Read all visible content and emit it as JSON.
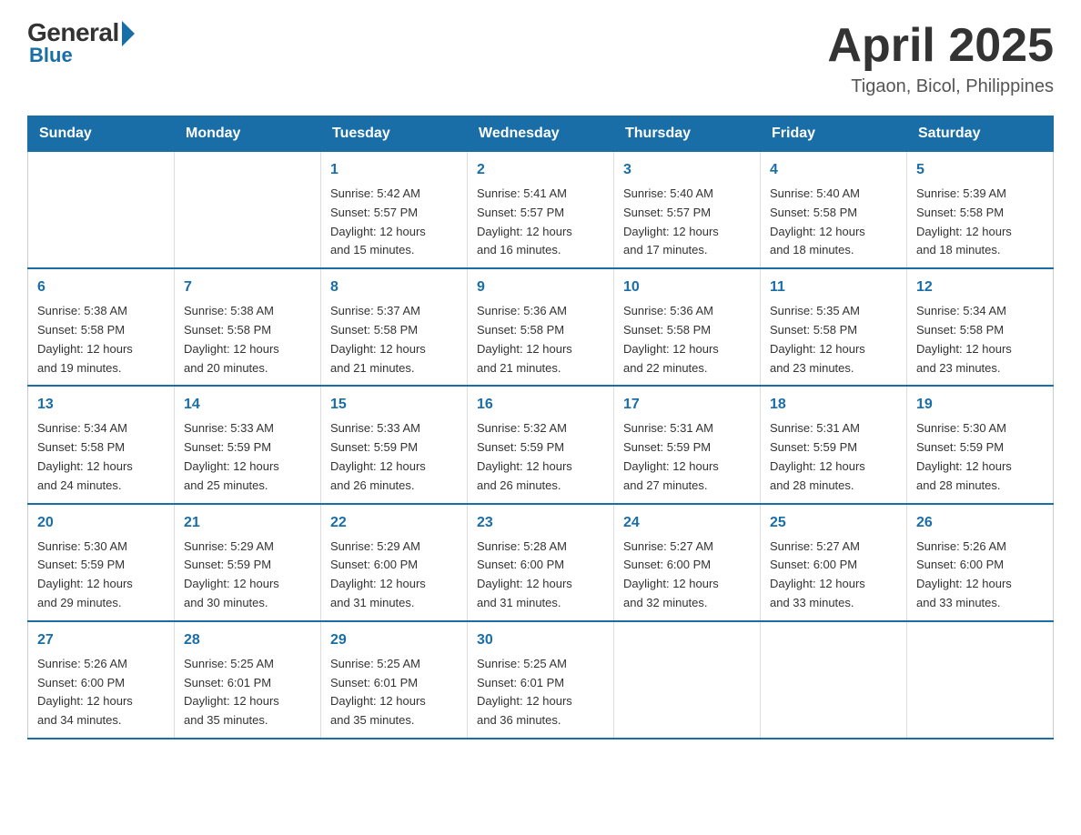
{
  "logo": {
    "general": "General",
    "blue": "Blue"
  },
  "header": {
    "month": "April 2025",
    "location": "Tigaon, Bicol, Philippines"
  },
  "days_of_week": [
    "Sunday",
    "Monday",
    "Tuesday",
    "Wednesday",
    "Thursday",
    "Friday",
    "Saturday"
  ],
  "weeks": [
    [
      {
        "day": "",
        "info": ""
      },
      {
        "day": "",
        "info": ""
      },
      {
        "day": "1",
        "info": "Sunrise: 5:42 AM\nSunset: 5:57 PM\nDaylight: 12 hours\nand 15 minutes."
      },
      {
        "day": "2",
        "info": "Sunrise: 5:41 AM\nSunset: 5:57 PM\nDaylight: 12 hours\nand 16 minutes."
      },
      {
        "day": "3",
        "info": "Sunrise: 5:40 AM\nSunset: 5:57 PM\nDaylight: 12 hours\nand 17 minutes."
      },
      {
        "day": "4",
        "info": "Sunrise: 5:40 AM\nSunset: 5:58 PM\nDaylight: 12 hours\nand 18 minutes."
      },
      {
        "day": "5",
        "info": "Sunrise: 5:39 AM\nSunset: 5:58 PM\nDaylight: 12 hours\nand 18 minutes."
      }
    ],
    [
      {
        "day": "6",
        "info": "Sunrise: 5:38 AM\nSunset: 5:58 PM\nDaylight: 12 hours\nand 19 minutes."
      },
      {
        "day": "7",
        "info": "Sunrise: 5:38 AM\nSunset: 5:58 PM\nDaylight: 12 hours\nand 20 minutes."
      },
      {
        "day": "8",
        "info": "Sunrise: 5:37 AM\nSunset: 5:58 PM\nDaylight: 12 hours\nand 21 minutes."
      },
      {
        "day": "9",
        "info": "Sunrise: 5:36 AM\nSunset: 5:58 PM\nDaylight: 12 hours\nand 21 minutes."
      },
      {
        "day": "10",
        "info": "Sunrise: 5:36 AM\nSunset: 5:58 PM\nDaylight: 12 hours\nand 22 minutes."
      },
      {
        "day": "11",
        "info": "Sunrise: 5:35 AM\nSunset: 5:58 PM\nDaylight: 12 hours\nand 23 minutes."
      },
      {
        "day": "12",
        "info": "Sunrise: 5:34 AM\nSunset: 5:58 PM\nDaylight: 12 hours\nand 23 minutes."
      }
    ],
    [
      {
        "day": "13",
        "info": "Sunrise: 5:34 AM\nSunset: 5:58 PM\nDaylight: 12 hours\nand 24 minutes."
      },
      {
        "day": "14",
        "info": "Sunrise: 5:33 AM\nSunset: 5:59 PM\nDaylight: 12 hours\nand 25 minutes."
      },
      {
        "day": "15",
        "info": "Sunrise: 5:33 AM\nSunset: 5:59 PM\nDaylight: 12 hours\nand 26 minutes."
      },
      {
        "day": "16",
        "info": "Sunrise: 5:32 AM\nSunset: 5:59 PM\nDaylight: 12 hours\nand 26 minutes."
      },
      {
        "day": "17",
        "info": "Sunrise: 5:31 AM\nSunset: 5:59 PM\nDaylight: 12 hours\nand 27 minutes."
      },
      {
        "day": "18",
        "info": "Sunrise: 5:31 AM\nSunset: 5:59 PM\nDaylight: 12 hours\nand 28 minutes."
      },
      {
        "day": "19",
        "info": "Sunrise: 5:30 AM\nSunset: 5:59 PM\nDaylight: 12 hours\nand 28 minutes."
      }
    ],
    [
      {
        "day": "20",
        "info": "Sunrise: 5:30 AM\nSunset: 5:59 PM\nDaylight: 12 hours\nand 29 minutes."
      },
      {
        "day": "21",
        "info": "Sunrise: 5:29 AM\nSunset: 5:59 PM\nDaylight: 12 hours\nand 30 minutes."
      },
      {
        "day": "22",
        "info": "Sunrise: 5:29 AM\nSunset: 6:00 PM\nDaylight: 12 hours\nand 31 minutes."
      },
      {
        "day": "23",
        "info": "Sunrise: 5:28 AM\nSunset: 6:00 PM\nDaylight: 12 hours\nand 31 minutes."
      },
      {
        "day": "24",
        "info": "Sunrise: 5:27 AM\nSunset: 6:00 PM\nDaylight: 12 hours\nand 32 minutes."
      },
      {
        "day": "25",
        "info": "Sunrise: 5:27 AM\nSunset: 6:00 PM\nDaylight: 12 hours\nand 33 minutes."
      },
      {
        "day": "26",
        "info": "Sunrise: 5:26 AM\nSunset: 6:00 PM\nDaylight: 12 hours\nand 33 minutes."
      }
    ],
    [
      {
        "day": "27",
        "info": "Sunrise: 5:26 AM\nSunset: 6:00 PM\nDaylight: 12 hours\nand 34 minutes."
      },
      {
        "day": "28",
        "info": "Sunrise: 5:25 AM\nSunset: 6:01 PM\nDaylight: 12 hours\nand 35 minutes."
      },
      {
        "day": "29",
        "info": "Sunrise: 5:25 AM\nSunset: 6:01 PM\nDaylight: 12 hours\nand 35 minutes."
      },
      {
        "day": "30",
        "info": "Sunrise: 5:25 AM\nSunset: 6:01 PM\nDaylight: 12 hours\nand 36 minutes."
      },
      {
        "day": "",
        "info": ""
      },
      {
        "day": "",
        "info": ""
      },
      {
        "day": "",
        "info": ""
      }
    ]
  ]
}
